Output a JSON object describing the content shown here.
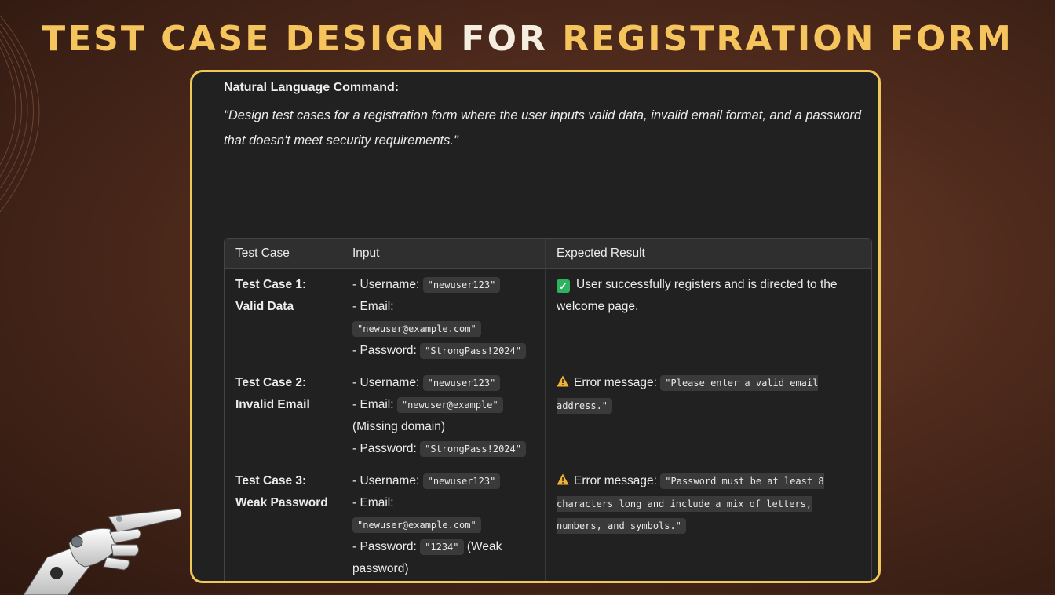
{
  "title": {
    "part1": "Test Case Design",
    "part2": "for",
    "part3": "Registration Form"
  },
  "nlc": {
    "label": "Natural Language Command:",
    "text": "\"Design test cases for a registration form where the user inputs valid data, invalid email format, and a password that doesn't meet security requirements.\""
  },
  "table": {
    "headers": [
      "Test Case",
      "Input",
      "Expected Result"
    ],
    "rows": [
      {
        "case_line1": "Test Case 1:",
        "case_line2": "Valid Data",
        "username_label": "- Username:",
        "username": "\"newuser123\"",
        "email_label": "- Email:",
        "email": "\"newuser@example.com\"",
        "password_label": "- Password:",
        "password": "\"StrongPass!2024\"",
        "result_icon": "check-mark-icon",
        "result_text": "User successfully registers and is directed to the welcome page."
      },
      {
        "case_line1": "Test Case 2:",
        "case_line2": "Invalid Email",
        "username_label": "- Username:",
        "username": "\"newuser123\"",
        "email_label": "- Email:",
        "email": "\"newuser@example\"",
        "email_note": "(Missing domain)",
        "password_label": "- Password:",
        "password": "\"StrongPass!2024\"",
        "result_icon": "warning-icon",
        "result_prefix": "Error message:",
        "result_code": "\"Please enter a valid email address.\""
      },
      {
        "case_line1": "Test Case 3:",
        "case_line2": "Weak Password",
        "username_label": "- Username:",
        "username": "\"newuser123\"",
        "email_label": "- Email:",
        "email": "\"newuser@example.com\"",
        "password_label": "- Password:",
        "password": "\"1234\"",
        "password_note": "(Weak password)",
        "result_icon": "warning-icon",
        "result_prefix": "Error message:",
        "result_code": "\"Password must be at least 8 characters long and include a mix of letters, numbers, and symbols.\""
      }
    ]
  },
  "colors": {
    "title": "#f6c45c",
    "card_border": "#f0c75a",
    "card_bg": "#212121",
    "check": "#2db35f",
    "warning": "#f2b233"
  }
}
